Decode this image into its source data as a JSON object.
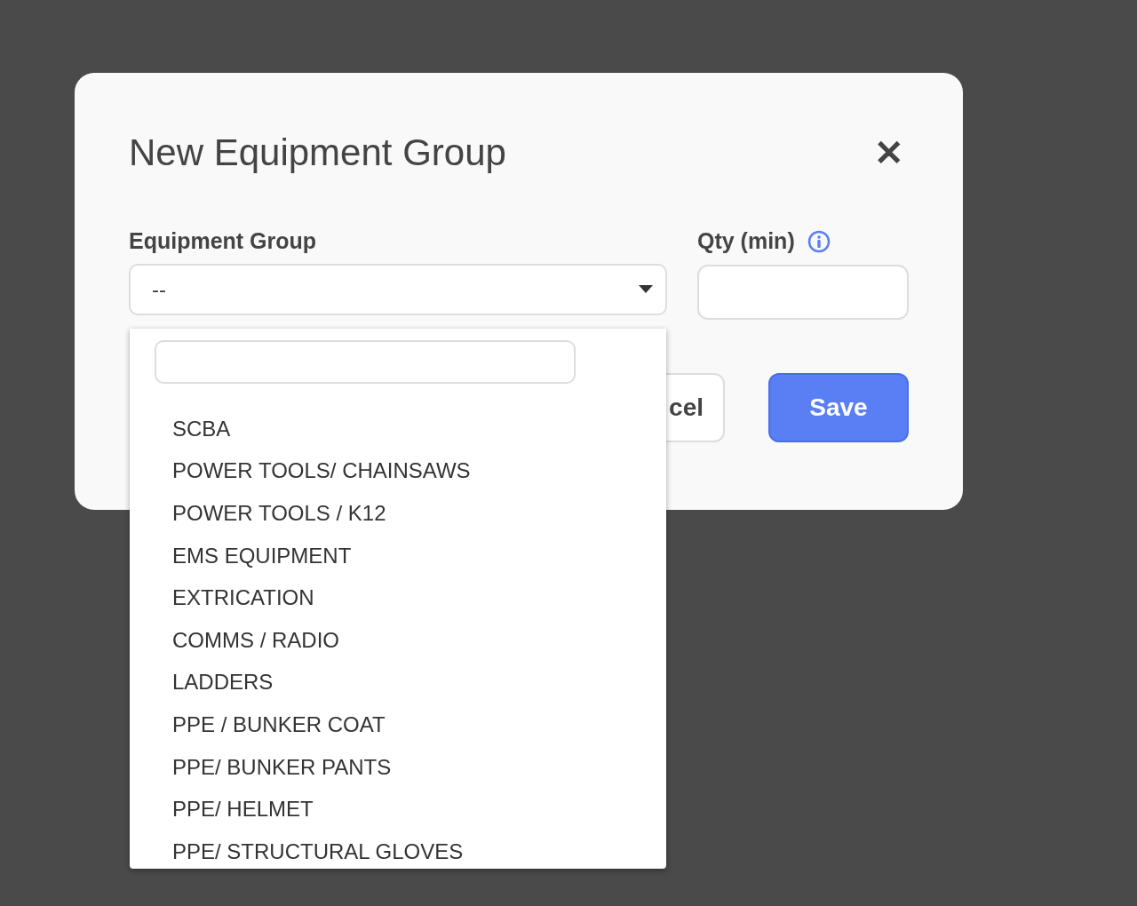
{
  "dialog": {
    "title": "New Equipment Group",
    "close": "✕"
  },
  "fields": [
    {
      "kind": "select",
      "label": "Equipment Group",
      "value": "--",
      "info": false
    },
    {
      "kind": "input",
      "label": "Qty (min)",
      "info": true
    }
  ],
  "buttons": [
    {
      "kind": "secondary",
      "label": "cel"
    },
    {
      "kind": "primary",
      "label": "Save"
    }
  ],
  "dropdown": {
    "open": true,
    "options": [
      {
        "label": "SCBA"
      },
      {
        "label": "POWER TOOLS/ CHAINSAWS"
      },
      {
        "label": "POWER TOOLS / K12"
      },
      {
        "label": "EMS EQUIPMENT"
      },
      {
        "label": "EXTRICATION"
      },
      {
        "label": "COMMS / RADIO"
      },
      {
        "label": "LADDERS"
      },
      {
        "label": "PPE / BUNKER COAT"
      },
      {
        "label": "PPE/ BUNKER PANTS"
      },
      {
        "label": "PPE/ HELMET"
      },
      {
        "label": "PPE/ STRUCTURAL GLOVES"
      }
    ]
  }
}
